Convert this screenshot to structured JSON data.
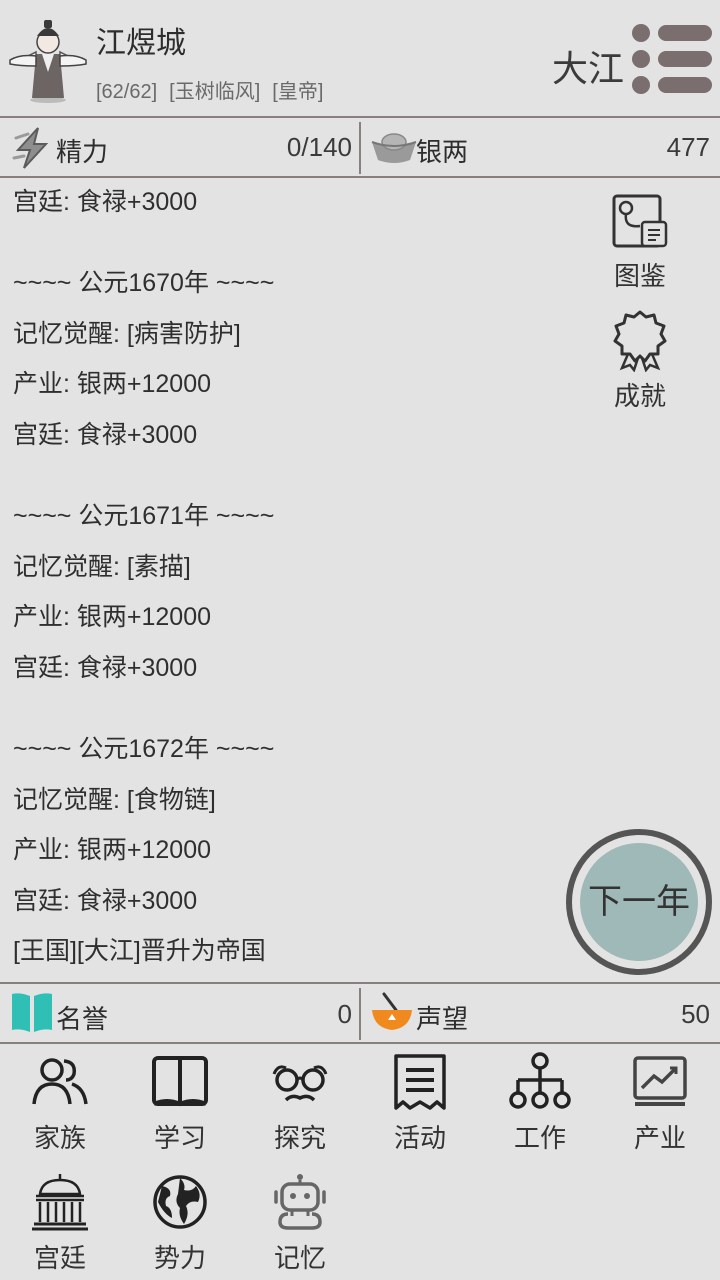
{
  "header": {
    "player_name": "江煜城",
    "tags": [
      "[62/62]",
      "[玉树临风]",
      "[皇帝]"
    ],
    "country": "大江"
  },
  "stats_top": {
    "energy": {
      "label": "精力",
      "value": "0/140",
      "icon": "lightning-icon"
    },
    "silver": {
      "label": "银两",
      "value": "477",
      "icon": "silver-ingot-icon"
    }
  },
  "log": [
    "宫廷: 食禄+3000",
    "",
    "~~~~ 公元1670年 ~~~~",
    "记忆觉醒: [病害防护]",
    "产业: 银两+12000",
    "宫廷: 食禄+3000",
    "",
    "~~~~ 公元1671年 ~~~~",
    "记忆觉醒: [素描]",
    "产业: 银两+12000",
    "宫廷: 食禄+3000",
    "",
    "~~~~ 公元1672年 ~~~~",
    "记忆觉醒: [食物链]",
    "产业: 银两+12000",
    "宫廷: 食禄+3000",
    "[王国][大江]晋升为帝国"
  ],
  "side_tools": {
    "encyclopedia": "图鉴",
    "achievements": "成就"
  },
  "next_year": "下一年",
  "stats_bottom": {
    "honor": {
      "label": "名誉",
      "value": "0",
      "icon": "book-icon"
    },
    "reputation": {
      "label": "声望",
      "value": "50",
      "icon": "bowl-icon"
    }
  },
  "nav": [
    {
      "label": "家族",
      "icon": "people-icon"
    },
    {
      "label": "学习",
      "icon": "open-book-icon"
    },
    {
      "label": "探究",
      "icon": "glasses-icon"
    },
    {
      "label": "活动",
      "icon": "receipt-icon"
    },
    {
      "label": "工作",
      "icon": "org-chart-icon"
    },
    {
      "label": "产业",
      "icon": "chart-icon"
    },
    {
      "label": "宫廷",
      "icon": "palace-icon"
    },
    {
      "label": "势力",
      "icon": "globe-icon"
    },
    {
      "label": "记忆",
      "icon": "robot-icon"
    }
  ],
  "colors": {
    "background": "#e3e3e3",
    "divider": "#8a7f7f",
    "next_year_fill": "#9fb8b8",
    "honor_icon": "#2fbfb5",
    "reputation_icon": "#f08a1e"
  }
}
